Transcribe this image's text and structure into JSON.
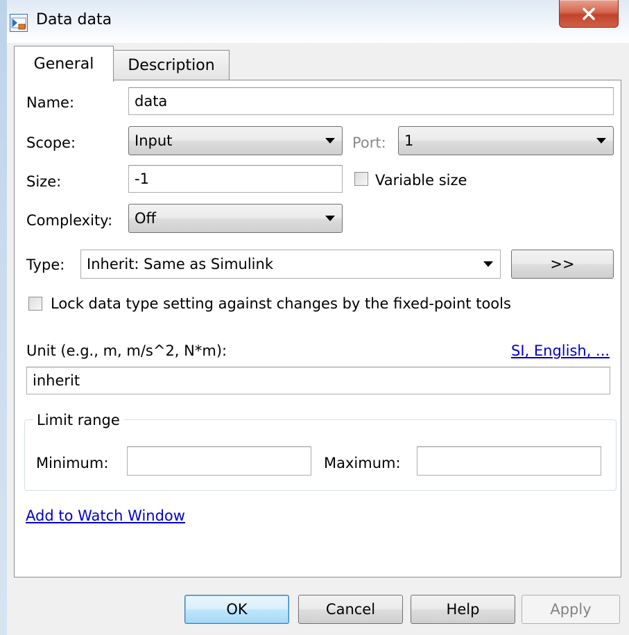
{
  "window": {
    "title": "Data data",
    "app_icon": "simulink-data-icon",
    "close_icon": "close-x-icon"
  },
  "tabs": [
    {
      "label": "General",
      "selected": true
    },
    {
      "label": "Description",
      "selected": false
    }
  ],
  "general": {
    "name_label": "Name:",
    "name_value": "data",
    "scope_label": "Scope:",
    "scope_value": "Input",
    "port_label": "Port:",
    "port_value": "1",
    "size_label": "Size:",
    "size_value": "-1",
    "variable_size_label": "Variable size",
    "variable_size_checked": false,
    "complexity_label": "Complexity:",
    "complexity_value": "Off",
    "type_label": "Type:",
    "type_value": "Inherit: Same as Simulink",
    "type_assistant_label": ">>",
    "lock_label": "Lock data type setting against changes by the fixed-point tools",
    "lock_checked": false,
    "unit_label": "Unit (e.g., m, m/s^2, N*m):",
    "unit_link": "SI, English, ...",
    "unit_value": "inherit",
    "limit_range": {
      "title": "Limit range",
      "minimum_label": "Minimum:",
      "minimum_value": "",
      "maximum_label": "Maximum:",
      "maximum_value": ""
    },
    "watch_link": "Add to Watch Window"
  },
  "buttons": {
    "ok": "OK",
    "cancel": "Cancel",
    "help": "Help",
    "apply": "Apply"
  },
  "colors": {
    "link": "#0000cc",
    "close_button": "#c2432a",
    "default_button": "#bee6fd"
  }
}
